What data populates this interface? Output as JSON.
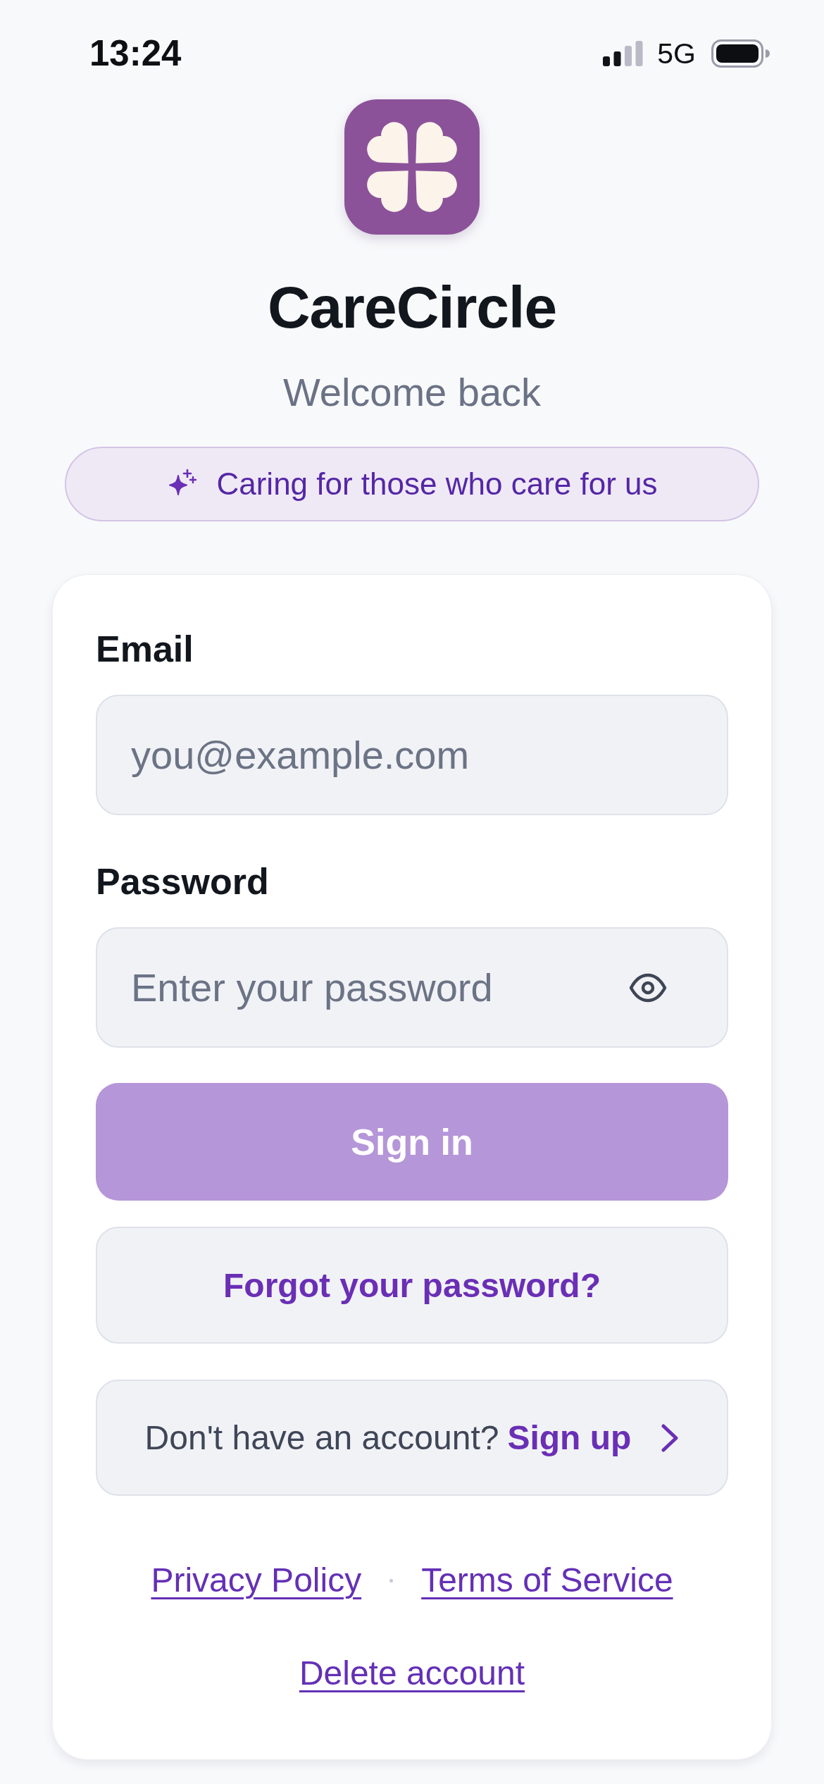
{
  "status_bar": {
    "time": "13:24",
    "network": "5G"
  },
  "header": {
    "title": "CareCircle",
    "subtitle": "Welcome back"
  },
  "tagline": {
    "text": "Caring for those who care for us"
  },
  "form": {
    "fields": [
      {
        "kind": "email",
        "label": "Email",
        "placeholder": "you@example.com"
      },
      {
        "kind": "password",
        "label": "Password",
        "placeholder": "Enter your password"
      }
    ],
    "sign_in": {
      "label": "Sign in",
      "disabled": true
    },
    "forgot_password": {
      "label": "Forgot your password?"
    },
    "sign_up": {
      "prompt": "Don't have an account?",
      "action": "Sign up"
    }
  },
  "footer": {
    "links": [
      {
        "label": "Privacy Policy"
      },
      {
        "label": "Terms of Service"
      }
    ],
    "delete_account": {
      "label": "Delete account"
    }
  }
}
